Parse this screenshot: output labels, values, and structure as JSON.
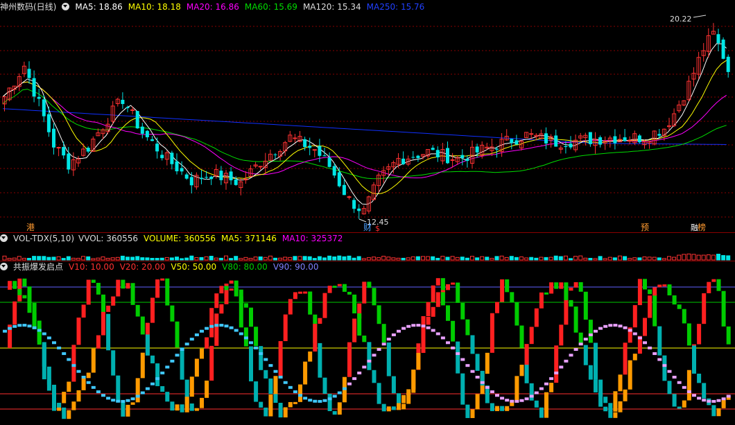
{
  "main_header": {
    "stock_name": "神州数码(日线)",
    "ma5": "MA5: 18.86",
    "ma10": "MA10: 18.18",
    "ma20": "MA20: 16.86",
    "ma60": "MA60: 15.69",
    "ma120": "MA120: 15.34",
    "ma250": "MA250: 15.76"
  },
  "price_annotations": {
    "high": "20.22",
    "low": "12.45"
  },
  "event_markers": {
    "m1": "港",
    "m2": "财",
    "m3": "$",
    "m4": "预",
    "m5": "融",
    "m6": "榜"
  },
  "vol_header": {
    "name": "VOL-TDX(5,10)",
    "vvol": "VVOL: 360556",
    "volume": "VOLUME: 360556",
    "ma5": "MA5: 371146",
    "ma10": "MA10: 325372"
  },
  "ind_header": {
    "name": "共振爆发启点",
    "v10": "V10: 10.00",
    "v20": "V20: 20.00",
    "v50": "V50: 50.00",
    "v80": "V80: 80.00",
    "v90": "V90: 90.00"
  },
  "colors": {
    "up": "#ff3232",
    "down": "#00e5e5",
    "ma5": "#ffffff",
    "ma10": "#ffff00",
    "ma20": "#ff00ff",
    "ma60": "#00dd00",
    "ma120": "#1030ff",
    "ma250": "#1030ff",
    "grid": "#8a0000",
    "v10": "#ff3030",
    "v20": "#ff3030",
    "v50": "#ffff00",
    "v80": "#00cc00",
    "v90": "#6060ff"
  },
  "chart_data": {
    "type": "candlestick",
    "price_ylim": [
      12.0,
      21.0
    ],
    "indicator_ylim": [
      0,
      100
    ],
    "indicator_levels": [
      10,
      20,
      50,
      80,
      90
    ],
    "high_label_price": 20.22,
    "low_label_price": 12.45
  }
}
